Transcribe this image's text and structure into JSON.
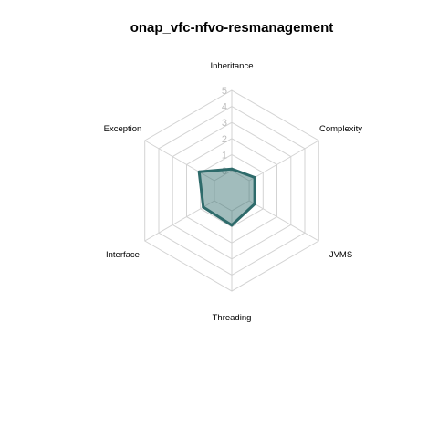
{
  "chart_data": {
    "type": "radar",
    "title": "onap_vfc-nfvo-resmanagement",
    "axes": [
      "Inheritance",
      "Complexity",
      "JVMS",
      "Threading",
      "Interface",
      "Exception"
    ],
    "ticks": [
      "0",
      "1",
      "2",
      "3",
      "4",
      "5"
    ],
    "range": [
      0,
      5
    ],
    "series": [
      {
        "values": [
          0.1,
          0.4,
          0.4,
          0.9,
          0.8,
          1.1
        ]
      }
    ],
    "colors": {
      "grid": "#d3d3d3",
      "line": "#2e6b6b",
      "fill": "#2e6b6b",
      "ticks": "#bdbdbd"
    }
  }
}
